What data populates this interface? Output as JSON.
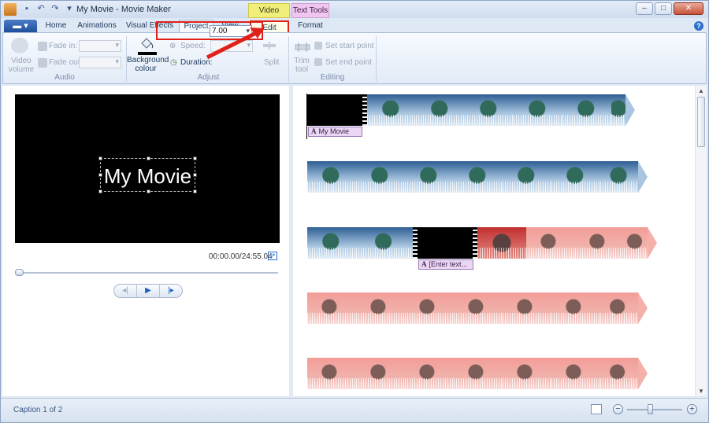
{
  "title_bar": {
    "title": "My Movie - Movie Maker",
    "context_tabs": [
      "Video Tools",
      "Text Tools"
    ]
  },
  "tabs": [
    {
      "label": "Home"
    },
    {
      "label": "Animations"
    },
    {
      "label": "Visual Effects"
    },
    {
      "label": "Project"
    },
    {
      "label": "View"
    },
    {
      "label": "Edit"
    },
    {
      "label": "Format"
    }
  ],
  "ribbon": {
    "audio": {
      "video_volume": "Video volume",
      "fade_in": "Fade in:",
      "fade_out": "Fade out:",
      "group_label": "Audio"
    },
    "adjust": {
      "background_colour": "Background colour",
      "speed": "Speed:",
      "duration_label": "Duration:",
      "duration_value": "7.00",
      "split": "Split",
      "group_label": "Adjust"
    },
    "editing": {
      "trim_tool": "Trim tool",
      "set_start_point": "Set start point",
      "set_end_point": "Set end point",
      "group_label": "Editing"
    }
  },
  "preview": {
    "caption": "My Movie",
    "timecode": "00:00.00/24:55.04"
  },
  "storyboard": {
    "caption_tags": [
      "My Movie",
      "[Enter text..."
    ]
  },
  "status": {
    "text": "Caption 1 of 2"
  },
  "icons": {
    "qat": [
      "save-icon",
      "undo-icon",
      "redo-icon",
      "customize-icon"
    ],
    "window": [
      "minimize-icon",
      "maximize-icon",
      "close-icon"
    ]
  }
}
